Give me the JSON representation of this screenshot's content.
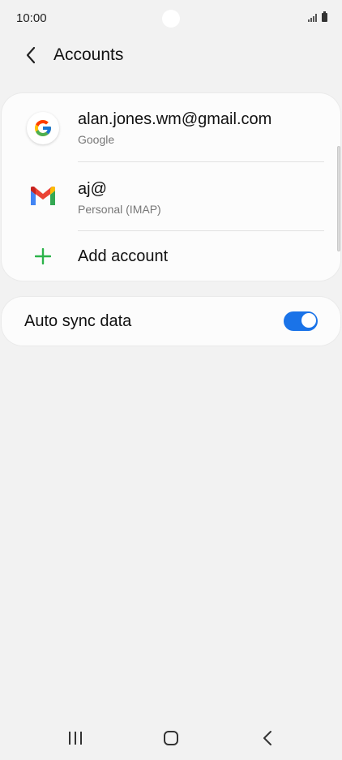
{
  "status_bar": {
    "time": "10:00"
  },
  "header": {
    "title": "Accounts",
    "back_icon": "chevron-left-icon"
  },
  "accounts": [
    {
      "name": "alan.jones.wm@gmail.com",
      "type": "Google",
      "icon": "google-icon"
    },
    {
      "name": "aj@",
      "type": "Personal (IMAP)",
      "icon": "gmail-icon"
    }
  ],
  "add_account": {
    "label": "Add account",
    "icon": "plus-icon",
    "color": "#2cb34a"
  },
  "auto_sync": {
    "label": "Auto sync data",
    "enabled": true,
    "accent_color": "#1a73e8"
  },
  "nav_bar": {
    "recents_icon": "recent-apps-icon",
    "home_icon": "home-icon",
    "back_icon": "back-icon"
  }
}
